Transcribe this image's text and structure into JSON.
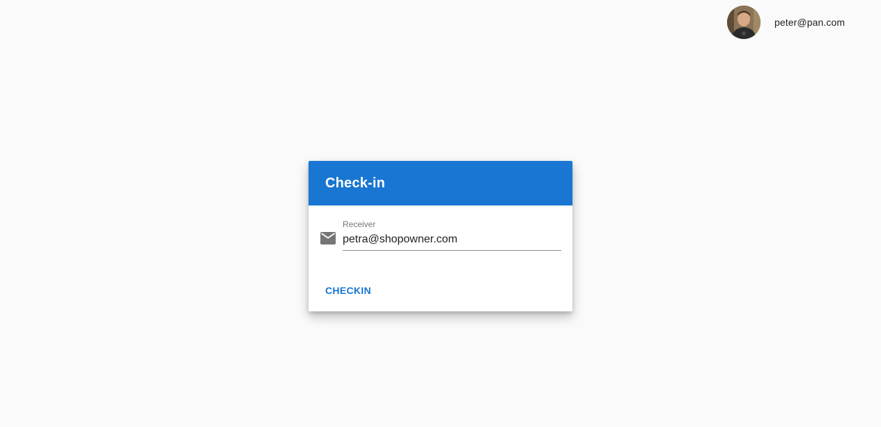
{
  "user": {
    "email": "peter@pan.com",
    "avatar_icon": "user-avatar-photo"
  },
  "dialog": {
    "title": "Check-in",
    "receiver_field": {
      "label": "Receiver",
      "value": "petra@shopowner.com",
      "icon": "mail-icon"
    },
    "checkin_button_label": "CHECKIN"
  },
  "colors": {
    "primary": "#1976d2",
    "background": "#fafafa"
  }
}
